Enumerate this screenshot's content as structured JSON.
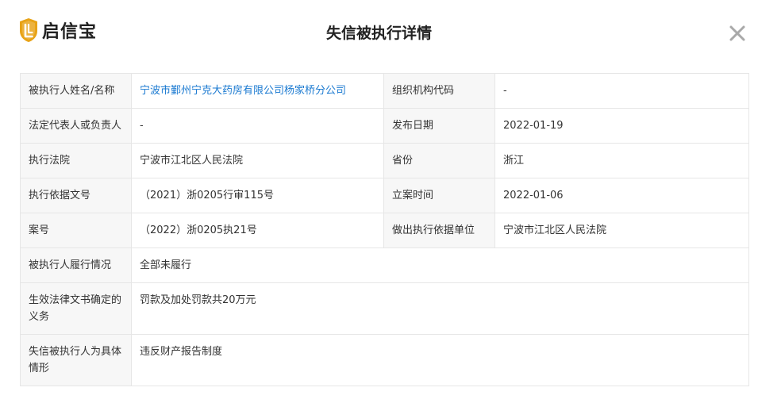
{
  "header": {
    "logo_text": "启信宝",
    "title": "失信被执行详情",
    "close_icon": "close-icon"
  },
  "colors": {
    "link": "#1b7ad1",
    "logo_shield": "#e8a317",
    "label_bg": "#f7f7f7",
    "border": "#e6e6e6"
  },
  "rows": [
    {
      "label": "被执行人姓名/名称",
      "value": "宁波市鄞州宁克大药房有限公司杨家桥分公司",
      "label2": "组织机构代码",
      "value2": "-"
    },
    {
      "label": "法定代表人或负责人",
      "value": "-",
      "label2": "发布日期",
      "value2": "2022-01-19"
    },
    {
      "label": "执行法院",
      "value": "宁波市江北区人民法院",
      "label2": "省份",
      "value2": "浙江"
    },
    {
      "label": "执行依据文号",
      "value": "（2021）浙0205行审115号",
      "label2": "立案时间",
      "value2": "2022-01-06"
    },
    {
      "label": "案号",
      "value": "（2022）浙0205执21号",
      "label2": "做出执行依据单位",
      "value2": "宁波市江北区人民法院"
    },
    {
      "label": "被执行人履行情况",
      "value": "全部未履行"
    },
    {
      "label": "生效法律文书确定的义务",
      "value": "罚款及加处罚款共20万元"
    },
    {
      "label": "失信被执行人为具体情形",
      "value": "违反财产报告制度"
    }
  ]
}
